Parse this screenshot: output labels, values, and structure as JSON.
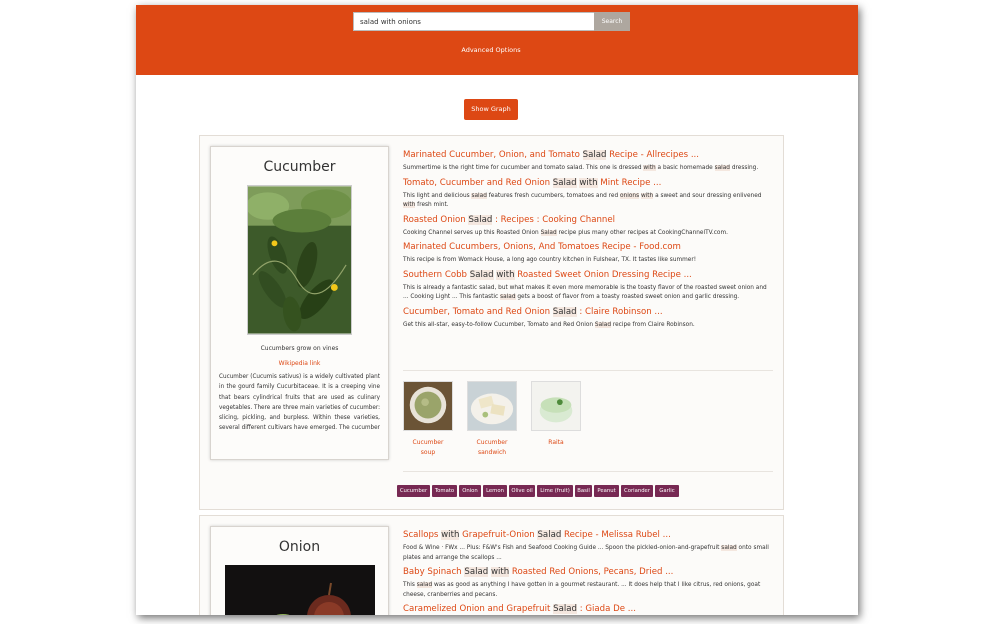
{
  "search": {
    "value": "salad with onions",
    "button_label": "Search"
  },
  "advanced_label": "Advanced Options",
  "show_graph_label": "Show Graph",
  "results": [
    {
      "card": {
        "title": "Cucumber",
        "caption": "Cucumbers grow on vines",
        "wiki_label": "Wikipedia link",
        "description": "Cucumber (Cucumis sativus) is a widely cultivated plant in the gourd family Cucurbitaceae. It is a creeping vine that bears cylindrical fruits that are used as culinary vegetables. There are three main varieties of cucumber: slicing, pickling, and burpless. Within these varieties, several different cultivars have emerged. The cucumber is originally"
      },
      "links": [
        {
          "title": [
            [
              "Marinated Cucumber, Onion, and Tomato ",
              false
            ],
            [
              "Salad",
              true
            ],
            [
              " Recipe - Allrecipes ...",
              false
            ]
          ],
          "snippet": [
            [
              "Summertime is the right time for cucumber and tomato salad. This one is dressed ",
              false
            ],
            [
              "with",
              true
            ],
            [
              " a basic homemade ",
              false
            ],
            [
              "salad",
              true
            ],
            [
              " dressing.",
              false
            ]
          ]
        },
        {
          "title": [
            [
              "Tomato, Cucumber and Red Onion ",
              false
            ],
            [
              "Salad",
              true
            ],
            [
              " ",
              false
            ],
            [
              "with",
              true
            ],
            [
              " Mint Recipe ...",
              false
            ]
          ],
          "snippet": [
            [
              "This light and delicious ",
              false
            ],
            [
              "salad",
              true
            ],
            [
              " features fresh cucumbers, tomatoes and red ",
              false
            ],
            [
              "onions",
              true
            ],
            [
              " ",
              false
            ],
            [
              "with",
              true
            ],
            [
              " a sweet and sour dressing enlivened ",
              false
            ],
            [
              "with",
              true
            ],
            [
              " fresh mint.",
              false
            ]
          ]
        },
        {
          "title": [
            [
              "Roasted Onion ",
              false
            ],
            [
              "Salad",
              true
            ],
            [
              " : Recipes : Cooking Channel",
              false
            ]
          ],
          "snippet": [
            [
              "Cooking Channel serves up this Roasted Onion ",
              false
            ],
            [
              "Salad",
              true
            ],
            [
              " recipe plus many other recipes at CookingChannelTV.com.",
              false
            ]
          ]
        },
        {
          "title": [
            [
              "Marinated Cucumbers, Onions, And Tomatoes Recipe - Food.com",
              false
            ]
          ],
          "snippet": [
            [
              "This recipe is from Womack House, a long ago country kitchen in Fulshear, TX. It tastes like summer!",
              false
            ]
          ]
        },
        {
          "title": [
            [
              "Southern Cobb ",
              false
            ],
            [
              "Salad",
              true
            ],
            [
              " ",
              false
            ],
            [
              "with",
              true
            ],
            [
              " Roasted Sweet Onion Dressing Recipe ...",
              false
            ]
          ],
          "snippet": [
            [
              "This is already a fantastic salad, but what makes it even more memorable is the toasty flavor of the roasted sweet onion and ... Cooking Light ... This fantastic ",
              false
            ],
            [
              "salad",
              true
            ],
            [
              " gets a boost of flavor from a toasty roasted sweet onion and garlic dressing.",
              false
            ]
          ]
        },
        {
          "title": [
            [
              "Cucumber, Tomato and Red Onion ",
              false
            ],
            [
              "Salad",
              true
            ],
            [
              " : Claire Robinson ...",
              false
            ]
          ],
          "snippet": [
            [
              "Get this all-star, easy-to-follow Cucumber, Tomato and Red Onion ",
              false
            ],
            [
              "Salad",
              true
            ],
            [
              " recipe from Claire Robinson.",
              false
            ]
          ]
        }
      ],
      "thumbnails": [
        {
          "label": "Cucumber soup",
          "line1": "Cucumber",
          "line2": "soup"
        },
        {
          "label": "Cucumber sandwich",
          "line1": "Cucumber",
          "line2": "sandwich"
        },
        {
          "label": "Raita",
          "line1": "Raita",
          "line2": ""
        }
      ],
      "tags": [
        "Cucumber",
        "Tomato",
        "Onion",
        "Lemon",
        "Olive oil",
        "Lime (fruit)",
        "Basil",
        "Peanut",
        "Coriander",
        "Garlic"
      ]
    },
    {
      "card": {
        "title": "Onion"
      },
      "links": [
        {
          "title": [
            [
              "Scallops ",
              false
            ],
            [
              "with",
              true
            ],
            [
              " Grapefruit-Onion ",
              false
            ],
            [
              "Salad",
              true
            ],
            [
              " Recipe - Melissa Rubel ...",
              false
            ]
          ],
          "snippet": [
            [
              "Food & Wine · FWx ... Plus: F&W's Fish and Seafood Cooking Guide ... Spoon the pickled-onion-and-grapefruit ",
              false
            ],
            [
              "salad",
              true
            ],
            [
              " onto small plates and arrange the scallops ...",
              false
            ]
          ]
        },
        {
          "title": [
            [
              "Baby Spinach ",
              false
            ],
            [
              "Salad",
              true
            ],
            [
              " ",
              false
            ],
            [
              "with",
              true
            ],
            [
              " Roasted Red Onions, Pecans, Dried ...",
              false
            ]
          ],
          "snippet": [
            [
              "This ",
              false
            ],
            [
              "salad",
              true
            ],
            [
              " was as good as anything I have gotten in a gourmet restaurant. ... It does help that I like citrus, red onions, goat cheese, cranberries and pecans.",
              false
            ]
          ]
        },
        {
          "title": [
            [
              "Caramelized Onion and Grapefruit ",
              false
            ],
            [
              "Salad",
              true
            ],
            [
              " : Giada De ...",
              false
            ]
          ],
          "snippet": []
        }
      ]
    }
  ],
  "colors": {
    "brand": "#dd4814",
    "tag": "#772953",
    "button_gray": "#aea79f",
    "highlight": "#f4e7df"
  }
}
